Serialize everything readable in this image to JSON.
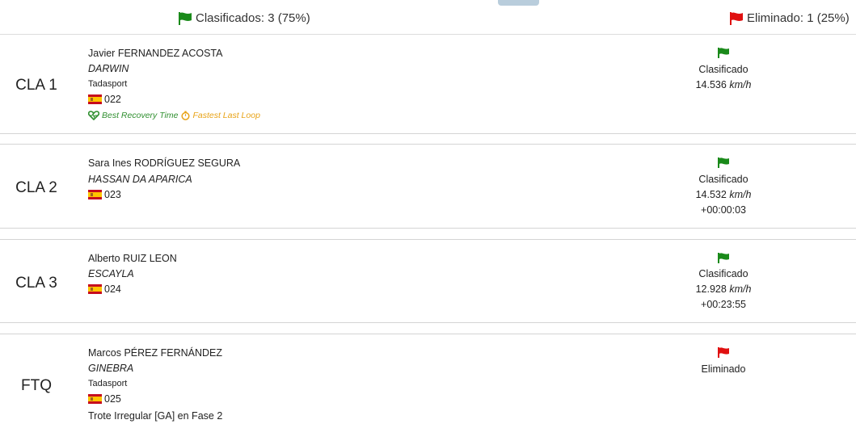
{
  "summary": {
    "qualified_label": "Clasificados: 3 (75%)",
    "eliminated_label": "Eliminado: 1 (25%)",
    "qualified_color": "#1a8a1a",
    "eliminated_color": "#e01010"
  },
  "results": [
    {
      "position": "CLA 1",
      "rider": "Javier FERNANDEZ ACOSTA",
      "horse": "DARWIN",
      "team": "Tadasport",
      "country_flag": "spain-flag",
      "bib": "022",
      "badges": {
        "best_recovery": "Best Recovery Time",
        "fastest_loop": "Fastest Last Loop"
      },
      "status": "Clasificado",
      "status_flag": "green-flag",
      "speed": "14.536",
      "speed_unit": "km/h",
      "gap": ""
    },
    {
      "position": "CLA 2",
      "rider": "Sara Ines RODRÍGUEZ SEGURA",
      "horse": "HASSAN DA APARICA",
      "team": "",
      "country_flag": "spain-flag",
      "bib": "023",
      "status": "Clasificado",
      "status_flag": "green-flag",
      "speed": "14.532",
      "speed_unit": "km/h",
      "gap": "+00:00:03"
    },
    {
      "position": "CLA 3",
      "rider": "Alberto RUIZ LEON",
      "horse": "ESCAYLA",
      "team": "",
      "country_flag": "spain-flag",
      "bib": "024",
      "status": "Clasificado",
      "status_flag": "green-flag",
      "speed": "12.928",
      "speed_unit": "km/h",
      "gap": "+00:23:55"
    },
    {
      "position": "FTQ",
      "rider": "Marcos PÉREZ FERNÁNDEZ",
      "horse": "GINEBRA",
      "team": "Tadasport",
      "country_flag": "spain-flag",
      "bib": "025",
      "note": "Trote Irregular [GA] en Fase 2",
      "status": "Eliminado",
      "status_flag": "red-flag"
    }
  ]
}
